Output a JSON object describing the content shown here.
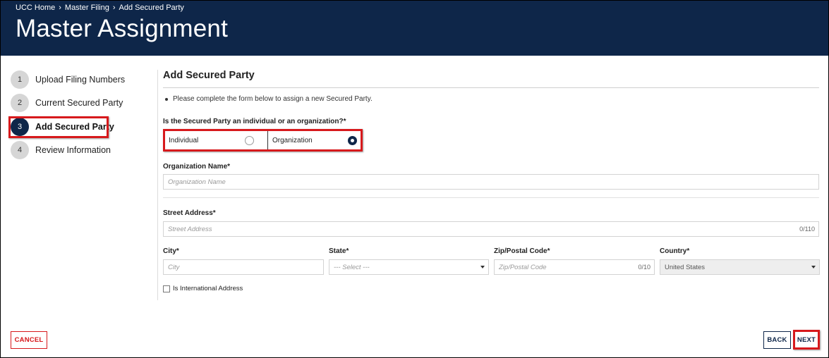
{
  "breadcrumb": [
    {
      "label": "UCC Home"
    },
    {
      "label": "Master Filing"
    },
    {
      "label": "Add Secured Party"
    }
  ],
  "page_title": "Master Assignment",
  "steps": [
    {
      "num": "1",
      "label": "Upload Filing Numbers",
      "active": false
    },
    {
      "num": "2",
      "label": "Current Secured Party",
      "active": false
    },
    {
      "num": "3",
      "label": "Add Secured Party",
      "active": true
    },
    {
      "num": "4",
      "label": "Review Information",
      "active": false
    }
  ],
  "form": {
    "title": "Add Secured Party",
    "instructions": "Please complete the form below to assign a new Secured Party.",
    "party_type_question": "Is the Secured Party an individual or an organization?",
    "required_mark": "*",
    "party_type_options": [
      {
        "label": "Individual",
        "selected": false
      },
      {
        "label": "Organization",
        "selected": true
      }
    ],
    "org_name": {
      "label": "Organization Name",
      "placeholder": "Organization Name",
      "value": ""
    },
    "street": {
      "label": "Street Address",
      "placeholder": "Street Address",
      "value": "",
      "counter": "0/110"
    },
    "city": {
      "label": "City",
      "placeholder": "City",
      "value": ""
    },
    "state": {
      "label": "State",
      "selected": "--- Select ---"
    },
    "zip": {
      "label": "Zip/Postal Code",
      "placeholder": "Zip/Postal Code",
      "value": "",
      "counter": "0/10"
    },
    "country": {
      "label": "Country",
      "selected": "United States"
    },
    "international": {
      "label": "Is International Address",
      "checked": false
    }
  },
  "buttons": {
    "cancel": "CANCEL",
    "back": "BACK",
    "next": "NEXT"
  },
  "colors": {
    "header_bg": "#0e2649",
    "highlight": "#d7191c",
    "step_inactive": "#d6d6d6"
  }
}
